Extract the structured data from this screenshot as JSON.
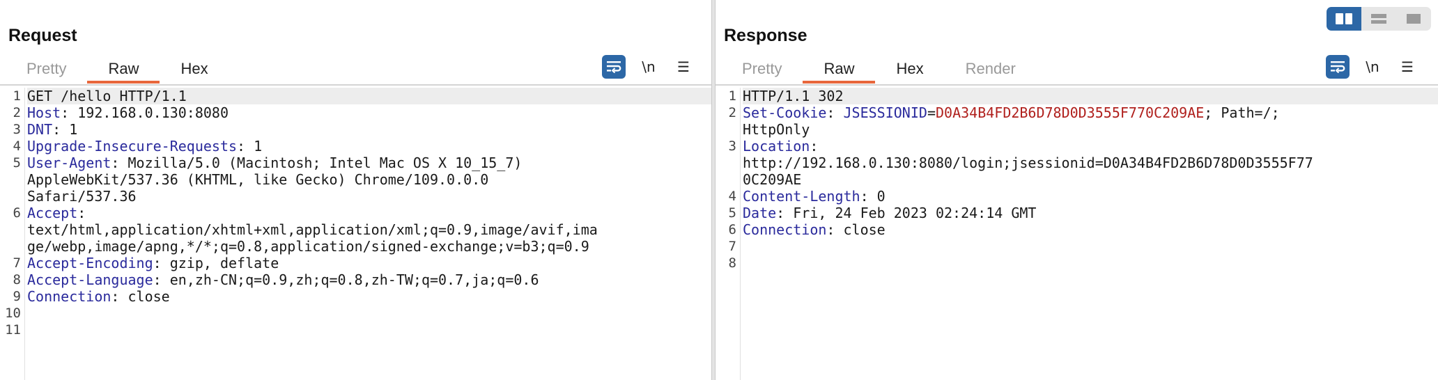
{
  "request": {
    "title": "Request",
    "tabs": [
      "Pretty",
      "Raw",
      "Hex"
    ],
    "active_tab": "Raw",
    "toolbar": {
      "newline_label": "\\n",
      "menu_label": "☰"
    },
    "lines": [
      {
        "n": "1",
        "parts": [
          {
            "t": "GET /hello HTTP/1.1",
            "c": "v"
          }
        ],
        "hl": true
      },
      {
        "n": "2",
        "parts": [
          {
            "t": "Host",
            "c": "k"
          },
          {
            "t": ": 192.168.0.130:8080",
            "c": "v"
          }
        ]
      },
      {
        "n": "3",
        "parts": [
          {
            "t": "DNT",
            "c": "k"
          },
          {
            "t": ": 1",
            "c": "v"
          }
        ]
      },
      {
        "n": "4",
        "parts": [
          {
            "t": "Upgrade-Insecure-Requests",
            "c": "k"
          },
          {
            "t": ": 1",
            "c": "v"
          }
        ]
      },
      {
        "n": "5",
        "parts": [
          {
            "t": "User-Agent",
            "c": "k"
          },
          {
            "t": ": Mozilla/5.0 (Macintosh; Intel Mac OS X 10_15_7)",
            "c": "v"
          }
        ]
      },
      {
        "n": "",
        "parts": [
          {
            "t": "AppleWebKit/537.36 (KHTML, like Gecko) Chrome/109.0.0.0",
            "c": "v"
          }
        ]
      },
      {
        "n": "",
        "parts": [
          {
            "t": "Safari/537.36",
            "c": "v"
          }
        ]
      },
      {
        "n": "6",
        "parts": [
          {
            "t": "Accept",
            "c": "k"
          },
          {
            "t": ":",
            "c": "v"
          }
        ]
      },
      {
        "n": "",
        "parts": [
          {
            "t": "text/html,application/xhtml+xml,application/xml;q=0.9,image/avif,ima",
            "c": "v"
          }
        ]
      },
      {
        "n": "",
        "parts": [
          {
            "t": "ge/webp,image/apng,*/*;q=0.8,application/signed-exchange;v=b3;q=0.9",
            "c": "v"
          }
        ]
      },
      {
        "n": "7",
        "parts": [
          {
            "t": "Accept-Encoding",
            "c": "k"
          },
          {
            "t": ": gzip, deflate",
            "c": "v"
          }
        ]
      },
      {
        "n": "8",
        "parts": [
          {
            "t": "Accept-Language",
            "c": "k"
          },
          {
            "t": ": en,zh-CN;q=0.9,zh;q=0.8,zh-TW;q=0.7,ja;q=0.6",
            "c": "v"
          }
        ]
      },
      {
        "n": "9",
        "parts": [
          {
            "t": "Connection",
            "c": "k"
          },
          {
            "t": ": close",
            "c": "v"
          }
        ]
      },
      {
        "n": "10",
        "parts": []
      },
      {
        "n": "11",
        "parts": []
      }
    ]
  },
  "response": {
    "title": "Response",
    "tabs": [
      "Pretty",
      "Raw",
      "Hex",
      "Render"
    ],
    "active_tab": "Raw",
    "toolbar": {
      "newline_label": "\\n",
      "menu_label": "☰"
    },
    "lines": [
      {
        "n": "1",
        "parts": [
          {
            "t": "HTTP/1.1 302",
            "c": "v"
          }
        ],
        "hl": true
      },
      {
        "n": "2",
        "parts": [
          {
            "t": "Set-Cookie",
            "c": "k"
          },
          {
            "t": ": ",
            "c": "v"
          },
          {
            "t": "JSESSIONID",
            "c": "k"
          },
          {
            "t": "=",
            "c": "v"
          },
          {
            "t": "D0A34B4FD2B6D78D0D3555F770C209AE",
            "c": "c"
          },
          {
            "t": "; Path=/;",
            "c": "v"
          }
        ]
      },
      {
        "n": "",
        "parts": [
          {
            "t": "HttpOnly",
            "c": "v"
          }
        ]
      },
      {
        "n": "3",
        "parts": [
          {
            "t": "Location",
            "c": "k"
          },
          {
            "t": ":",
            "c": "v"
          }
        ]
      },
      {
        "n": "",
        "parts": [
          {
            "t": "http://192.168.0.130:8080/login;jsessionid=D0A34B4FD2B6D78D0D3555F77",
            "c": "v"
          }
        ]
      },
      {
        "n": "",
        "parts": [
          {
            "t": "0C209AE",
            "c": "v"
          }
        ]
      },
      {
        "n": "4",
        "parts": [
          {
            "t": "Content-Length",
            "c": "k"
          },
          {
            "t": ": 0",
            "c": "v"
          }
        ]
      },
      {
        "n": "5",
        "parts": [
          {
            "t": "Date",
            "c": "k"
          },
          {
            "t": ": Fri, 24 Feb 2023 02:24:14 GMT",
            "c": "v"
          }
        ]
      },
      {
        "n": "6",
        "parts": [
          {
            "t": "Connection",
            "c": "k"
          },
          {
            "t": ": close",
            "c": "v"
          }
        ]
      },
      {
        "n": "7",
        "parts": []
      },
      {
        "n": "8",
        "parts": []
      }
    ]
  },
  "colors": {
    "accent_tab": "#e8673c",
    "header_key": "#2a2a9c",
    "cookie_value": "#b0201d",
    "button_blue": "#2c67a6"
  },
  "view_toggle": {
    "icons": [
      "side-by-side-icon",
      "stacked-icon",
      "single-pane-icon"
    ],
    "selected": "side-by-side-icon"
  }
}
